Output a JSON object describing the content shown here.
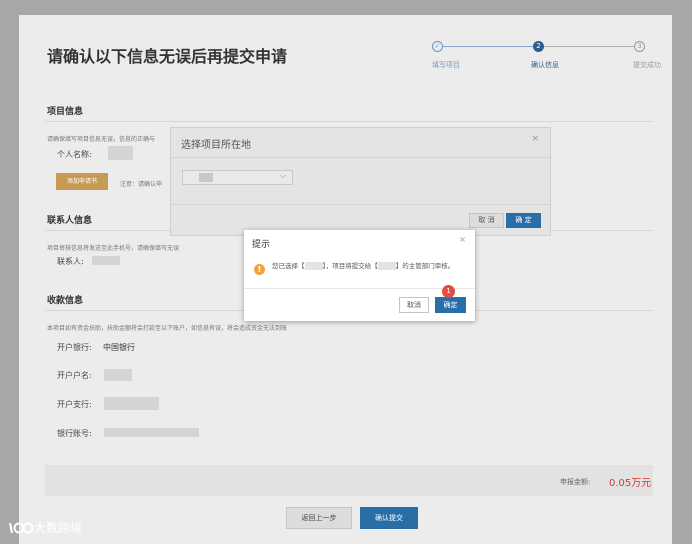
{
  "page": {
    "title": "请确认以下信息无误后再提交申请"
  },
  "steps": [
    {
      "num": "✓",
      "label": "填写项目",
      "state": "done"
    },
    {
      "num": "2",
      "label": "确认信息",
      "state": "active"
    },
    {
      "num": "3",
      "label": "提交成功",
      "state": "pending"
    }
  ],
  "project_info": {
    "heading": "项目信息",
    "hint": "请确保填写项目信息无误，信息的正确与",
    "personal_name_label": "个人名称:",
    "button_label": "添加申请书",
    "note_prefix": "注意：请确认申"
  },
  "contact_info": {
    "heading": "联系人信息",
    "hint": "项目审核信息将发送至此手机号，请确保填写无误",
    "contact_label": "联系人:"
  },
  "payment_info": {
    "heading": "收款信息",
    "hint": "本项目如有资金扶助，扶助金额将会打款至以下账户，如信息有误，将会造成资金无法到账",
    "bank_label": "开户银行:",
    "bank_value": "中国银行",
    "account_name_label": "开户户名:",
    "branch_label": "开户支行:",
    "account_no_label": "银行账号:"
  },
  "summary": {
    "amount_label": "申报金额:",
    "amount_value": "0.05万元"
  },
  "footer": {
    "back_label": "返回上一步",
    "submit_label": "确认提交"
  },
  "location_dialog": {
    "title": "选择项目所在地",
    "close": "×",
    "cancel_label": "取 消",
    "ok_label": "确 定"
  },
  "confirm_dialog": {
    "title": "提示",
    "close": "×",
    "warn_glyph": "!",
    "message_part1": "您已选择【",
    "message_part2": "】，项目将提交给【",
    "message_part3": "】的主管部门审核。",
    "cancel_label": "取消",
    "ok_label": "确定"
  },
  "tutorial_badge": "1",
  "watermark": "大数跨境",
  "colors": {
    "primary": "#2a6ea8",
    "warning": "#f0a33c",
    "badge": "#e54b44",
    "amount": "#d23a3a",
    "accent_button": "#c79a54"
  }
}
